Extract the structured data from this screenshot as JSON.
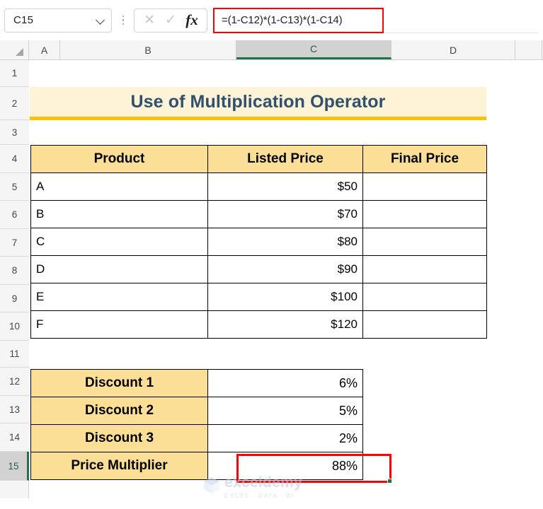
{
  "formula_bar": {
    "name_box_value": "C15",
    "name_box_icon": "chevron-down-icon",
    "cancel_icon": "cancel-x-icon",
    "confirm_icon": "confirm-check-icon",
    "function_icon": "fx-insert-function-icon",
    "formula_value": "=(1-C12)*(1-C13)*(1-C14)",
    "formula_highlight_color": "#ff0000"
  },
  "grid": {
    "columns": [
      "A",
      "B",
      "C",
      "D"
    ],
    "selected_column": "C",
    "rows": [
      "1",
      "2",
      "3",
      "4",
      "5",
      "6",
      "7",
      "8",
      "9",
      "10",
      "11",
      "12",
      "13",
      "14",
      "15"
    ],
    "selected_row": "15",
    "selected_cell": "C15",
    "selection_border_color": "#ff0000",
    "fill_handle_color": "#217346",
    "header_accent_color": "#217346"
  },
  "title": {
    "text": "Use of Multiplication Operator",
    "text_color": "#31506E",
    "background_color": "#FDF3D7",
    "underline_color": "#FFC000"
  },
  "product_table": {
    "header_background": "#FCDF96",
    "headers": [
      "Product",
      "Listed Price",
      "Final Price"
    ],
    "rows": [
      {
        "product": "A",
        "listed_price": "$50",
        "final_price": ""
      },
      {
        "product": "B",
        "listed_price": "$70",
        "final_price": ""
      },
      {
        "product": "C",
        "listed_price": "$80",
        "final_price": ""
      },
      {
        "product": "D",
        "listed_price": "$90",
        "final_price": ""
      },
      {
        "product": "E",
        "listed_price": "$100",
        "final_price": ""
      },
      {
        "product": "F",
        "listed_price": "$120",
        "final_price": ""
      }
    ]
  },
  "discount_table": {
    "label_background": "#FCDF96",
    "rows": [
      {
        "label": "Discount 1",
        "value": "6%"
      },
      {
        "label": "Discount 2",
        "value": "5%"
      },
      {
        "label": "Discount 3",
        "value": "2%"
      },
      {
        "label": "Price Multiplier",
        "value": "88%"
      }
    ]
  },
  "watermark": {
    "name": "exceldemy",
    "tagline": "EXCEL - DATA - BI",
    "icon": "cube-logo-icon"
  }
}
